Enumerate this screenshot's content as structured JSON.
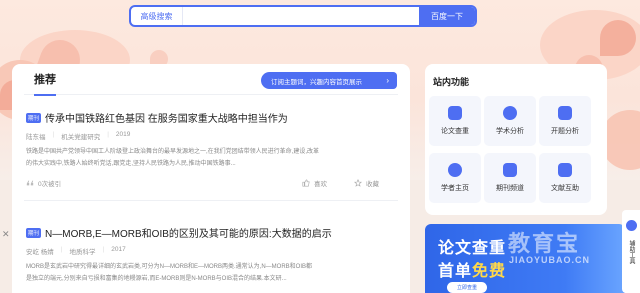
{
  "search": {
    "advanced_label": "高级搜索",
    "placeholder": "",
    "button_label": "百度一下"
  },
  "recommend": {
    "title": "推荐",
    "subscribe_text": "订阅主题词，兴趣内容首页展示",
    "subscribe_arrow": "›"
  },
  "articles": [
    {
      "tag": "期刊",
      "title": "传承中国铁路红色基因 在服务国家重大战略中担当作为",
      "author": "陆东福",
      "source": "机关党建研究",
      "year": "2019",
      "abstract_1": "铁路是中国共产党领导中国工人阶级登上政治舞台的最早发源地之一,在我们党团结带领人民进行革命,建设,改革",
      "abstract_2": "的伟大实践中,铁路人始终听党话,跟党走,坚持人民铁路为人民,推动中国铁路事...",
      "cited": "0次被引",
      "like": "喜欢",
      "collect": "收藏"
    },
    {
      "tag": "期刊",
      "title": "N—MORB,E—MORB和OIB的区别及其可能的原因:大数据的启示",
      "author": "安屹 杨婧",
      "source": "地质科学",
      "year": "2017",
      "abstract_1": "MORB是玄武岩中研究得最详细的玄武岩类,可分为N—MORB和E—MORB两类.通常认为,N—MORB和OIB都",
      "abstract_2": "是独立的端元,分别来自亏损和富集的地幔源岩,而E-MORB则是N-MORB与OIB混合的结果.本文研..."
    }
  ],
  "side": {
    "title": "站内功能",
    "tiles": [
      {
        "label": "论文查重",
        "icon": "doc-check-icon"
      },
      {
        "label": "学术分析",
        "icon": "analysis-icon"
      },
      {
        "label": "开题分析",
        "icon": "topic-icon"
      },
      {
        "label": "学者主页",
        "icon": "scholar-icon"
      },
      {
        "label": "期刊频道",
        "icon": "journal-icon"
      },
      {
        "label": "文献互助",
        "icon": "help-icon"
      }
    ]
  },
  "ad": {
    "line1": "论文查重",
    "line2_a": "首单",
    "line2_b": "免费",
    "button": "立即查重",
    "watermark_cn": "教育宝",
    "watermark_en": "JIAOYUBAO.CN"
  },
  "float_strip": {
    "text": "辅助工具"
  },
  "colors": {
    "accent": "#4e6ef2",
    "ad_highlight": "#ffd84a"
  }
}
